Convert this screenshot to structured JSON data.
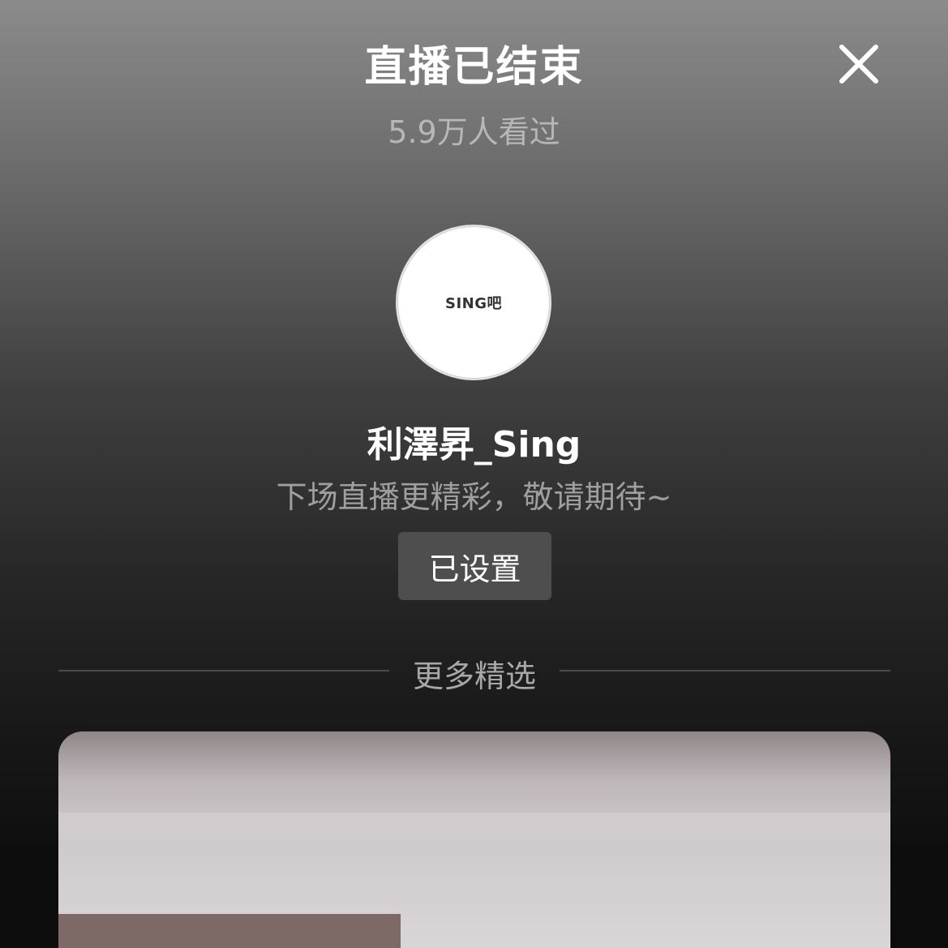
{
  "header": {
    "title": "直播已结束",
    "viewers_text": "5.9万人看过",
    "close_icon": "close-icon"
  },
  "streamer": {
    "avatar_text": "SING吧",
    "name": "利澤昇_Sing",
    "subtitle": "下场直播更精彩，敬请期待~",
    "remind_button_label": "已设置"
  },
  "more": {
    "section_label": "更多精选"
  },
  "colors": {
    "title": "#ffffff",
    "muted_text": "#9f9f9f",
    "button_bg": "#4e4e4e",
    "divider": "#4c4c4c"
  }
}
